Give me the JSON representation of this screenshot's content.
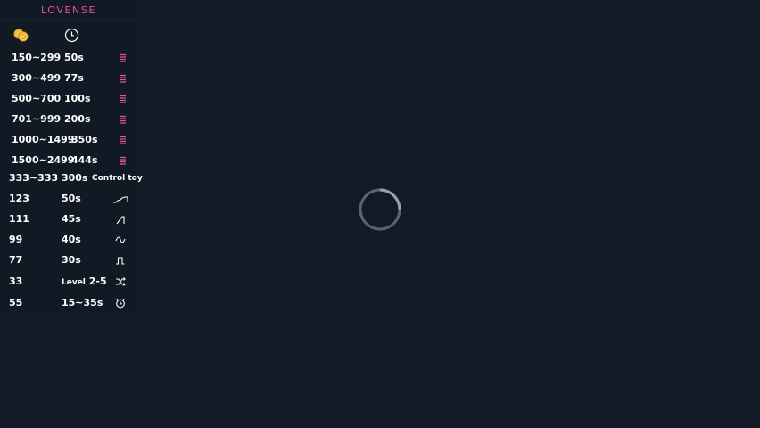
{
  "brand": {
    "name": "LOVENSE",
    "accent": "#e8519d"
  },
  "header": {
    "tokens_icon": "coins-icon",
    "duration_icon": "clock-icon"
  },
  "tip_levels": [
    {
      "range": "150~299",
      "duration": "50s",
      "icon": "vibration-bars-icon"
    },
    {
      "range": "300~499",
      "duration": "77s",
      "icon": "vibration-bars-icon"
    },
    {
      "range": "500~700",
      "duration": "100s",
      "icon": "vibration-bars-icon"
    },
    {
      "range": "701~999",
      "duration": "200s",
      "icon": "vibration-bars-icon"
    },
    {
      "range": "1000~1499",
      "duration": "350s",
      "icon": "vibration-bars-icon"
    },
    {
      "range": "1500~2499",
      "duration": "444s",
      "icon": "vibration-bars-icon"
    }
  ],
  "special_commands": [
    {
      "tokens": "333~333",
      "duration": "300s",
      "action": "Control toy"
    },
    {
      "tokens": "123",
      "duration": "50s",
      "icon": "earthquake-pattern-icon"
    },
    {
      "tokens": "111",
      "duration": "45s",
      "icon": "fireworks-pattern-icon"
    },
    {
      "tokens": "99",
      "duration": "40s",
      "icon": "wave-pattern-icon"
    },
    {
      "tokens": "77",
      "duration": "30s",
      "icon": "pulse-pattern-icon"
    },
    {
      "tokens": "33",
      "duration_prefix": "Level",
      "duration": "2-5",
      "icon": "random-shuffle-icon"
    },
    {
      "tokens": "55",
      "duration": "15~35s",
      "icon": "alarm-clock-icon"
    }
  ],
  "loading": {
    "icon": "loading-spinner-icon"
  }
}
